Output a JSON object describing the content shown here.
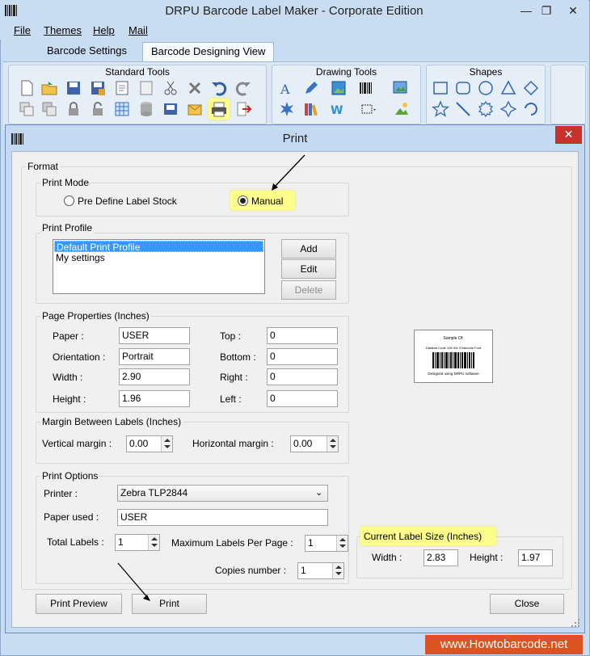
{
  "app": {
    "title": "DRPU Barcode Label Maker - Corporate Edition",
    "controls": {
      "minimize": "—",
      "restore": "❐",
      "close": "✕"
    }
  },
  "menu": [
    {
      "label": "File"
    },
    {
      "label": "Themes"
    },
    {
      "label": "Help"
    },
    {
      "label": "Mail"
    }
  ],
  "tabs": [
    {
      "label": "Barcode Settings",
      "active": false
    },
    {
      "label": "Barcode Designing View",
      "active": true
    }
  ],
  "ribbon": {
    "groups": [
      {
        "label": "Standard Tools"
      },
      {
        "label": "Drawing Tools"
      },
      {
        "label": "Shapes"
      }
    ]
  },
  "dialog": {
    "title": "Print",
    "close": "✕",
    "format": {
      "title": "Format",
      "print_mode": {
        "title": "Print Mode",
        "options": [
          "Pre Define Label Stock",
          "Manual"
        ],
        "selected": "Manual"
      },
      "print_profile": {
        "title": "Print Profile",
        "items": [
          "Default Print Profile",
          "My settings"
        ],
        "selected_index": 0,
        "buttons": {
          "add": "Add",
          "edit": "Edit",
          "delete": "Delete"
        }
      },
      "page_properties": {
        "title": "Page Properties (Inches)",
        "paper_label": "Paper :",
        "paper": "USER",
        "orientation_label": "Orientation :",
        "orientation": "Portrait",
        "width_label": "Width :",
        "width": "2.90",
        "height_label": "Height :",
        "height": "1.96",
        "top_label": "Top :",
        "top": "0",
        "bottom_label": "Bottom :",
        "bottom": "0",
        "right_label": "Right :",
        "right": "0",
        "left_label": "Left :",
        "left": "0"
      },
      "margin": {
        "title": "Margin Between Labels (Inches)",
        "vertical_label": "Vertical margin :",
        "vertical": "0.00",
        "horizontal_label": "Horizontal margin :",
        "horizontal": "0.00"
      },
      "print_options": {
        "title": "Print Options",
        "printer_label": "Printer :",
        "printer": "Zebra TLP2844",
        "paper_used_label": "Paper used :",
        "paper_used": "USER",
        "total_labels_label": "Total Labels :",
        "total_labels": "1",
        "max_per_page_label": "Maximum Labels Per Page :",
        "max_per_page": "1",
        "copies_label": "Copies number :",
        "copies": "1"
      }
    },
    "preview": {
      "line1": "Sample Of:",
      "line2": "Databar Code 128 Set 3 Barcode Font",
      "line3": "Designed using DRPU software"
    },
    "current_label": {
      "title": "Current Label Size (Inches)",
      "width_label": "Width :",
      "width": "2.83",
      "height_label": "Height :",
      "height": "1.97"
    },
    "buttons": {
      "preview": "Print Preview",
      "print": "Print",
      "close": "Close"
    }
  },
  "watermark": "www.Howtobarcode.net",
  "colors": {
    "highlight": "#fdfd8c",
    "selection": "#3399ff",
    "watermark": "#d9541e",
    "dialog_close": "#c7322a"
  }
}
